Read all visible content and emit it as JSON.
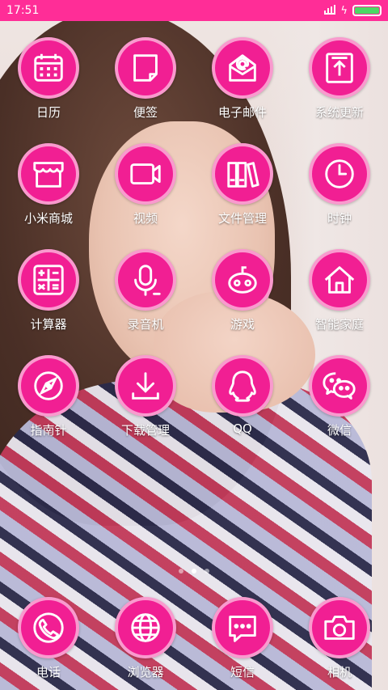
{
  "status_bar": {
    "time": "17:51",
    "battery_level": 1.0,
    "accent": "#ff2d97"
  },
  "icon_color": "#f11f93",
  "apps": [
    [
      {
        "label": "日历",
        "icon": "calendar-icon"
      },
      {
        "label": "便签",
        "icon": "note-icon"
      },
      {
        "label": "电子邮件",
        "icon": "email-icon"
      },
      {
        "label": "系统更新",
        "icon": "update-icon"
      }
    ],
    [
      {
        "label": "小米商城",
        "icon": "store-icon"
      },
      {
        "label": "视频",
        "icon": "video-icon"
      },
      {
        "label": "文件管理",
        "icon": "folder-icon"
      },
      {
        "label": "时钟",
        "icon": "clock-icon"
      }
    ],
    [
      {
        "label": "计算器",
        "icon": "calculator-icon"
      },
      {
        "label": "录音机",
        "icon": "microphone-icon"
      },
      {
        "label": "游戏",
        "icon": "game-icon"
      },
      {
        "label": "智能家庭",
        "icon": "home-icon"
      }
    ],
    [
      {
        "label": "指南针",
        "icon": "compass-icon"
      },
      {
        "label": "下载管理",
        "icon": "download-icon"
      },
      {
        "label": "QQ",
        "icon": "qq-icon"
      },
      {
        "label": "微信",
        "icon": "wechat-icon"
      }
    ]
  ],
  "pages": {
    "count": 3,
    "current": 2
  },
  "dock": [
    {
      "label": "电话",
      "icon": "phone-icon"
    },
    {
      "label": "浏览器",
      "icon": "browser-icon"
    },
    {
      "label": "短信",
      "icon": "message-icon"
    },
    {
      "label": "相机",
      "icon": "camera-icon"
    }
  ]
}
